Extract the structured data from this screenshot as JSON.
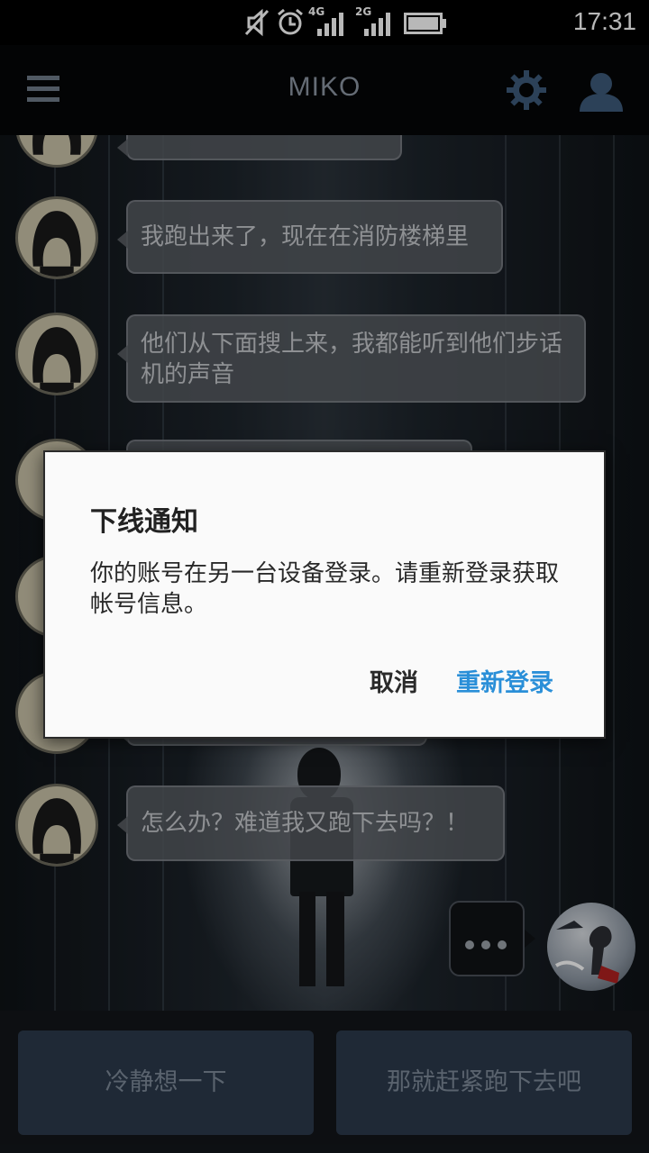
{
  "status_bar": {
    "time": "17:31",
    "icons": [
      "mute-icon",
      "alarm-icon",
      "signal-4g-icon",
      "signal-2g-icon",
      "battery-icon"
    ],
    "network_labels": [
      "4G",
      "2G"
    ]
  },
  "header": {
    "title": "MIKO",
    "icons": [
      "menu-icon",
      "gear-icon",
      "user-icon"
    ]
  },
  "chat": {
    "messages": [
      {
        "sender": "miko",
        "text": "我跑出来了，现在在消防楼梯里"
      },
      {
        "sender": "miko",
        "text": "他们从下面搜上来，我都能听到他们步话机的声音"
      },
      {
        "sender": "miko",
        "text": "怎么办？难道我又跑下去吗？！"
      }
    ],
    "typing_indicator": "..."
  },
  "choices": [
    {
      "label": "冷静想一下"
    },
    {
      "label": "那就赶紧跑下去吧"
    }
  ],
  "dialog": {
    "title": "下线通知",
    "message": "你的账号在另一台设备登录。请重新登录获取帐号信息。",
    "cancel": "取消",
    "confirm": "重新登录",
    "confirm_color": "#2a8fd8"
  }
}
